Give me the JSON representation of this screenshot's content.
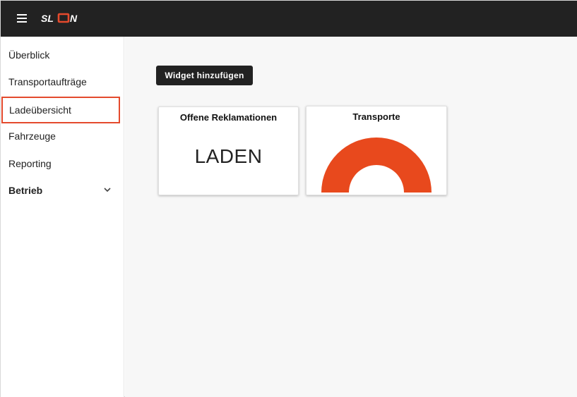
{
  "header": {
    "menu_icon": "hamburger-icon",
    "logo_text": "SLON",
    "logo_accent_color": "#E44A2D"
  },
  "sidebar": {
    "items": [
      {
        "label": "Überblick"
      },
      {
        "label": "Transportaufträge"
      },
      {
        "label": "Ladeübersicht",
        "active": true
      },
      {
        "label": "Fahrzeuge"
      },
      {
        "label": "Reporting"
      },
      {
        "label": "Betrieb",
        "expandable": true,
        "icon": "chevron-down-icon"
      }
    ]
  },
  "main": {
    "add_widget_label": "Widget hinzufügen",
    "widgets": [
      {
        "title": "Offene Reklamationen",
        "content": "LADEN"
      },
      {
        "title": "Transporte",
        "gauge_color": "#E8491D"
      }
    ]
  },
  "colors": {
    "topbar": "#222222",
    "accent": "#E44A2D",
    "gauge": "#E8491D",
    "background": "#F7F7F7"
  }
}
